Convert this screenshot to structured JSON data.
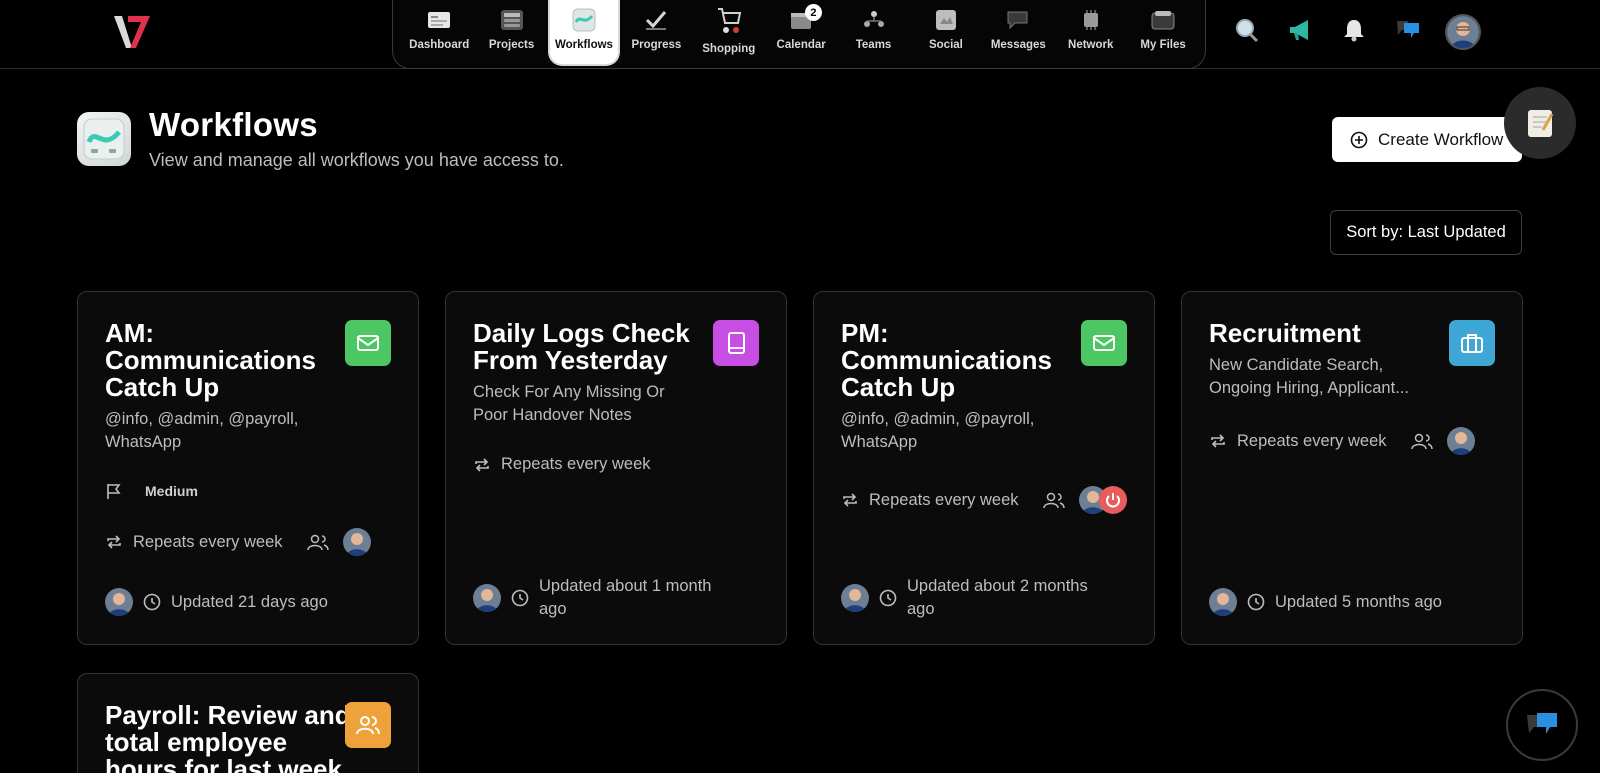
{
  "nav": {
    "items": [
      {
        "label": "Dashboard"
      },
      {
        "label": "Projects"
      },
      {
        "label": "Workflows"
      },
      {
        "label": "Progress"
      },
      {
        "label": "Shopping"
      },
      {
        "label": "Calendar",
        "badge": "2"
      },
      {
        "label": "Teams"
      },
      {
        "label": "Social"
      },
      {
        "label": "Messages"
      },
      {
        "label": "Network"
      },
      {
        "label": "My Files"
      }
    ]
  },
  "top_icons": [
    "search-icon",
    "megaphone-icon",
    "bell-icon",
    "chat-icon"
  ],
  "page": {
    "title": "Workflows",
    "subtitle": "View and manage all workflows you have access to.",
    "create_label": "Create Workflow",
    "sort_label": "Sort by: Last Updated"
  },
  "colors": {
    "green": "#4cc763",
    "purple": "#c84de3",
    "blue": "#3fa7d6",
    "orange": "#f0a23a"
  },
  "cards": [
    {
      "title": "AM: Communications Catch Up",
      "desc": "@info, @admin, @payroll, WhatsApp",
      "priority": "Medium",
      "repeat": "Repeats every week",
      "updated": "Updated 21 days ago",
      "icon": "mail-icon"
    },
    {
      "title": "Daily Logs Check From Yesterday",
      "desc": "Check For Any Missing Or Poor Handover Notes",
      "repeat": "Repeats every week",
      "updated": "Updated about 1 month ago",
      "icon": "book-icon"
    },
    {
      "title": "PM: Communications Catch Up",
      "desc": "@info, @admin, @payroll, WhatsApp",
      "repeat": "Repeats every week",
      "updated": "Updated about 2 months ago",
      "icon": "mail-icon"
    },
    {
      "title": "Recruitment",
      "desc": "New Candidate Search, Ongoing Hiring, Applicant...",
      "repeat": "Repeats every week",
      "updated": "Updated 5 months ago",
      "icon": "briefcase-icon"
    },
    {
      "title": "Payroll: Review and total employee hours for last week",
      "icon": "users-icon"
    }
  ]
}
